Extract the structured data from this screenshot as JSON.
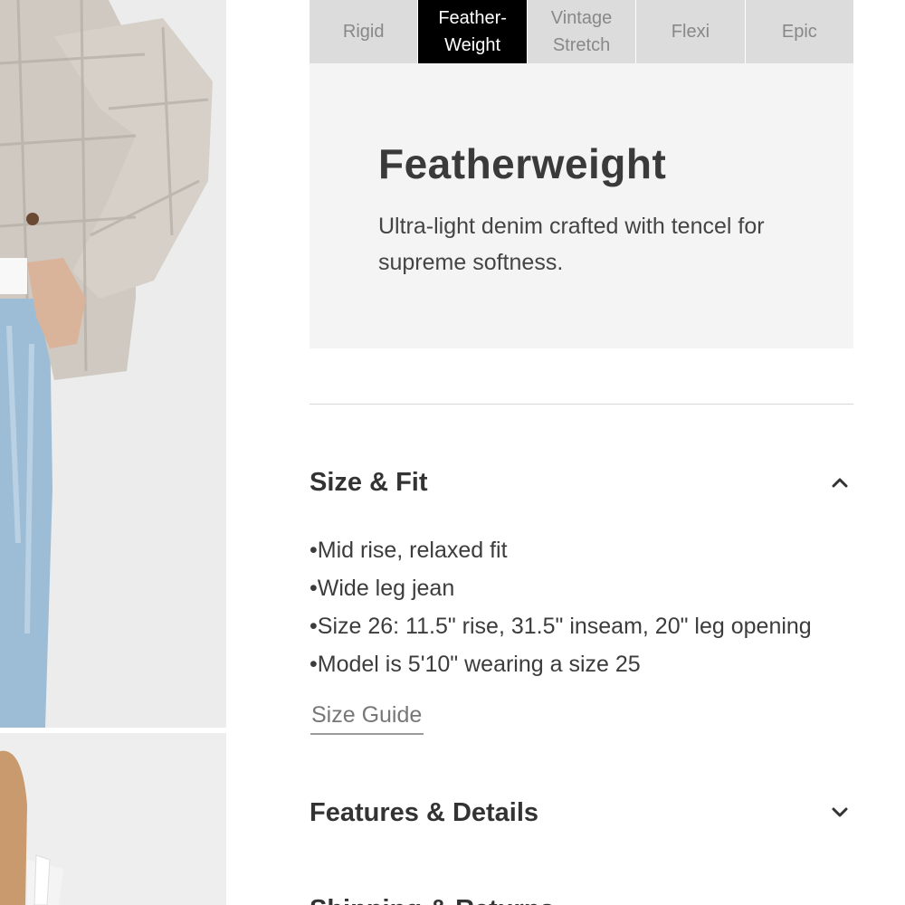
{
  "tabs": [
    {
      "label": "Rigid",
      "active": false
    },
    {
      "label": "Feather-\nWeight",
      "active": true
    },
    {
      "label": "Vintage\nStretch",
      "active": false
    },
    {
      "label": "Flexi",
      "active": false
    },
    {
      "label": "Epic",
      "active": false
    }
  ],
  "description": {
    "title": "Featherweight",
    "text": "Ultra-light denim crafted with tencel for supreme softness."
  },
  "size_fit": {
    "title": "Size & Fit",
    "expanded": true,
    "items": [
      "Mid rise, relaxed fit",
      "Wide leg jean",
      "Size 26: 11.5\" rise, 31.5\" inseam, 20\" leg opening",
      "Model is 5'10\" wearing a size 25"
    ],
    "size_guide_label": "Size Guide"
  },
  "features": {
    "title": "Features & Details",
    "expanded": false
  },
  "shipping": {
    "title": "Shipping & Returns"
  },
  "colors": {
    "active_tab_bg": "#000000",
    "tab_bg": "#dcdcdc",
    "card_bg": "#f4f4f4",
    "denim": "#9dbdd6"
  },
  "icons": {
    "collapse": "chevron-up-icon",
    "expand": "chevron-down-icon"
  }
}
